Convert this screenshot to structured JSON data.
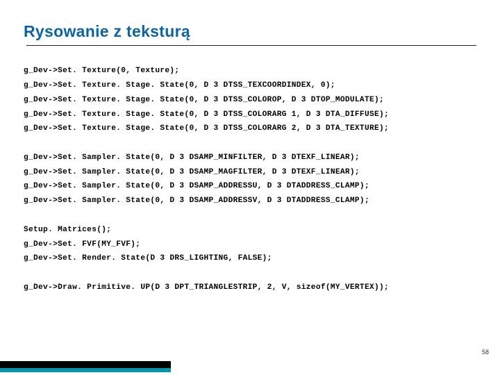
{
  "title": "Rysowanie z teksturą",
  "code": {
    "block1": "g_Dev->Set. Texture(0, Texture);\ng_Dev->Set. Texture. Stage. State(0, D 3 DTSS_TEXCOORDINDEX, 0);\ng_Dev->Set. Texture. Stage. State(0, D 3 DTSS_COLOROP, D 3 DTOP_MODULATE);\ng_Dev->Set. Texture. Stage. State(0, D 3 DTSS_COLORARG 1, D 3 DTA_DIFFUSE);\ng_Dev->Set. Texture. Stage. State(0, D 3 DTSS_COLORARG 2, D 3 DTA_TEXTURE);",
    "block2": "g_Dev->Set. Sampler. State(0, D 3 DSAMP_MINFILTER, D 3 DTEXF_LINEAR);\ng_Dev->Set. Sampler. State(0, D 3 DSAMP_MAGFILTER, D 3 DTEXF_LINEAR);\ng_Dev->Set. Sampler. State(0, D 3 DSAMP_ADDRESSU, D 3 DTADDRESS_CLAMP);\ng_Dev->Set. Sampler. State(0, D 3 DSAMP_ADDRESSV, D 3 DTADDRESS_CLAMP);",
    "block3": "Setup. Matrices();\ng_Dev->Set. FVF(MY_FVF);\ng_Dev->Set. Render. State(D 3 DRS_LIGHTING, FALSE);",
    "block4": "g_Dev->Draw. Primitive. UP(D 3 DPT_TRIANGLESTRIP, 2, V, sizeof(MY_VERTEX));"
  },
  "page_number": "58"
}
